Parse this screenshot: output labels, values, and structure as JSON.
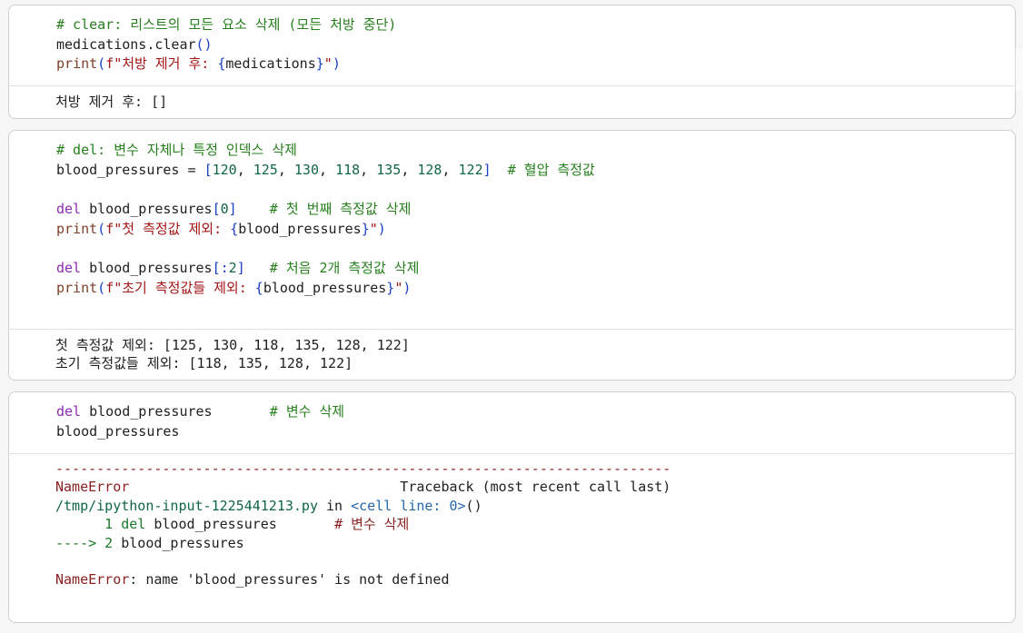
{
  "cells": [
    {
      "code": [
        [
          {
            "t": "# clear: 리스트의 모든 요소 삭제 (모든 처방 중단)",
            "c": "cm"
          }
        ],
        [
          {
            "t": "medications.clear",
            "c": ""
          },
          {
            "t": "()",
            "c": "pn"
          }
        ],
        [
          {
            "t": "print",
            "c": "fn"
          },
          {
            "t": "(",
            "c": "pn"
          },
          {
            "t": "f\"처방 제거 후: ",
            "c": "str"
          },
          {
            "t": "{",
            "c": "pn"
          },
          {
            "t": "medications",
            "c": ""
          },
          {
            "t": "}",
            "c": "pn"
          },
          {
            "t": "\"",
            "c": "str"
          },
          {
            "t": ")",
            "c": "pn"
          }
        ]
      ],
      "output": [
        [
          {
            "t": "처방 제거 후: []",
            "c": ""
          }
        ]
      ]
    },
    {
      "code": [
        [
          {
            "t": "# del: 변수 자체나 특정 인덱스 삭제",
            "c": "cm"
          }
        ],
        [
          {
            "t": "blood_pressures = ",
            "c": ""
          },
          {
            "t": "[",
            "c": "pn"
          },
          {
            "t": "120",
            "c": "num"
          },
          {
            "t": ", ",
            "c": ""
          },
          {
            "t": "125",
            "c": "num"
          },
          {
            "t": ", ",
            "c": ""
          },
          {
            "t": "130",
            "c": "num"
          },
          {
            "t": ", ",
            "c": ""
          },
          {
            "t": "118",
            "c": "num"
          },
          {
            "t": ", ",
            "c": ""
          },
          {
            "t": "135",
            "c": "num"
          },
          {
            "t": ", ",
            "c": ""
          },
          {
            "t": "128",
            "c": "num"
          },
          {
            "t": ", ",
            "c": ""
          },
          {
            "t": "122",
            "c": "num"
          },
          {
            "t": "]",
            "c": "pn"
          },
          {
            "t": "  # 혈압 측정값",
            "c": "cm"
          }
        ],
        [
          {
            "t": "",
            "c": ""
          }
        ],
        [
          {
            "t": "del",
            "c": "kw"
          },
          {
            "t": " blood_pressures",
            "c": ""
          },
          {
            "t": "[",
            "c": "pn"
          },
          {
            "t": "0",
            "c": "num"
          },
          {
            "t": "]",
            "c": "pn"
          },
          {
            "t": "    # 첫 번째 측정값 삭제",
            "c": "cm"
          }
        ],
        [
          {
            "t": "print",
            "c": "fn"
          },
          {
            "t": "(",
            "c": "pn"
          },
          {
            "t": "f\"첫 측정값 제외: ",
            "c": "str"
          },
          {
            "t": "{",
            "c": "pn"
          },
          {
            "t": "blood_pressures",
            "c": ""
          },
          {
            "t": "}",
            "c": "pn"
          },
          {
            "t": "\"",
            "c": "str"
          },
          {
            "t": ")",
            "c": "pn"
          }
        ],
        [
          {
            "t": "",
            "c": ""
          }
        ],
        [
          {
            "t": "del",
            "c": "kw"
          },
          {
            "t": " blood_pressures",
            "c": ""
          },
          {
            "t": "[:",
            "c": "pn"
          },
          {
            "t": "2",
            "c": "num"
          },
          {
            "t": "]",
            "c": "pn"
          },
          {
            "t": "   # 처음 2개 측정값 삭제",
            "c": "cm"
          }
        ],
        [
          {
            "t": "print",
            "c": "fn"
          },
          {
            "t": "(",
            "c": "pn"
          },
          {
            "t": "f\"초기 측정값들 제외: ",
            "c": "str"
          },
          {
            "t": "{",
            "c": "pn"
          },
          {
            "t": "blood_pressures",
            "c": ""
          },
          {
            "t": "}",
            "c": "pn"
          },
          {
            "t": "\"",
            "c": "str"
          },
          {
            "t": ")",
            "c": "pn"
          }
        ]
      ],
      "output": [
        [
          {
            "t": "첫 측정값 제외: [125, 130, 118, 135, 128, 122]",
            "c": ""
          }
        ],
        [
          {
            "t": "초기 측정값들 제외: [118, 135, 128, 122]",
            "c": ""
          }
        ]
      ]
    },
    {
      "code": [
        [
          {
            "t": "del",
            "c": "kw"
          },
          {
            "t": " blood_pressures",
            "c": ""
          },
          {
            "t": "       # 변수 삭제",
            "c": "cm"
          }
        ],
        [
          {
            "t": "blood_pressures",
            "c": ""
          }
        ]
      ],
      "output": [
        [
          {
            "t": "---------------------------------------------------------------------------",
            "c": "dash"
          }
        ],
        [
          {
            "t": "NameError",
            "c": "err"
          },
          {
            "t": "                                 Traceback (most recent call last)",
            "c": ""
          }
        ],
        [
          {
            "t": "/tmp/ipython-input-1225441213.py",
            "c": "tb-path"
          },
          {
            "t": " in ",
            "c": ""
          },
          {
            "t": "<cell line: 0>",
            "c": "tb-link"
          },
          {
            "t": "()",
            "c": ""
          }
        ],
        [
          {
            "t": "      1 ",
            "c": "tb-green"
          },
          {
            "t": "del",
            "c": "tb-green"
          },
          {
            "t": " blood_pressures       ",
            "c": ""
          },
          {
            "t": "# 변수 삭제",
            "c": "err"
          }
        ],
        [
          {
            "t": "----> 2 ",
            "c": "tb-green"
          },
          {
            "t": "blood_pressures",
            "c": ""
          }
        ],
        [
          {
            "t": "",
            "c": ""
          }
        ],
        [
          {
            "t": "NameError",
            "c": "err"
          },
          {
            "t": ": name 'blood_pressures' is not defined",
            "c": ""
          }
        ]
      ]
    }
  ]
}
